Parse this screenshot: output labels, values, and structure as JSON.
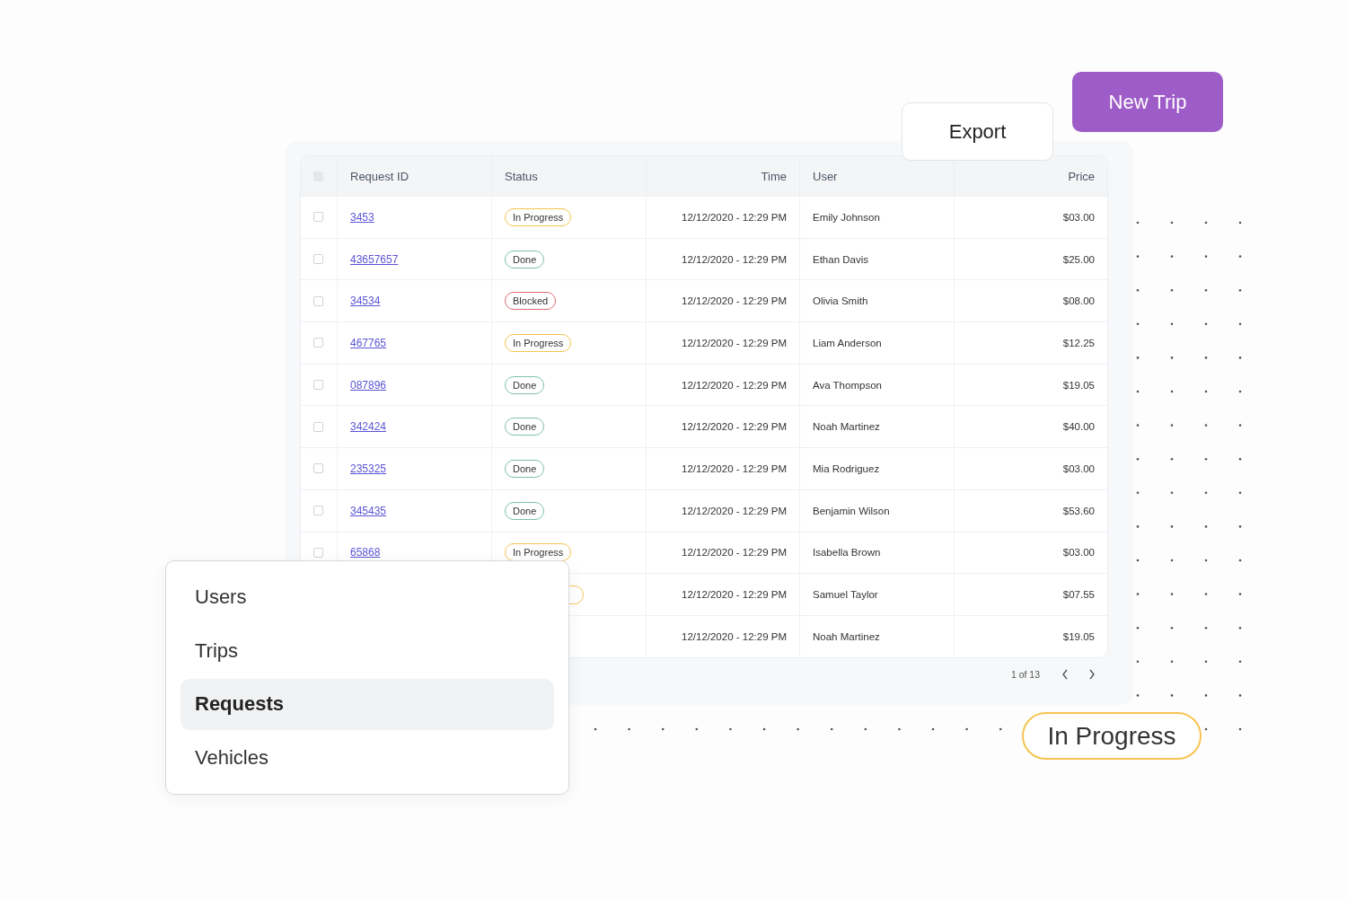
{
  "actions": {
    "export": "Export",
    "new_trip": "New Trip"
  },
  "table": {
    "select_all_checked": false,
    "columns": [
      "Request ID",
      "Status",
      "Time",
      "User",
      "Price"
    ],
    "rows": [
      {
        "checked": false,
        "id": "3453",
        "status": {
          "kind": "in_progress",
          "label": "In Progress"
        },
        "time": "12/12/2020 - 12:29 PM",
        "user": "Emily Johnson",
        "price": "$03.00"
      },
      {
        "checked": false,
        "id": "43657657",
        "status": {
          "kind": "done",
          "label": "Done"
        },
        "time": "12/12/2020 - 12:29 PM",
        "user": "Ethan Davis",
        "price": "$25.00"
      },
      {
        "checked": false,
        "id": "34534",
        "status": {
          "kind": "blocked",
          "label": "Blocked"
        },
        "time": "12/12/2020 - 12:29 PM",
        "user": "Olivia Smith",
        "price": "$08.00"
      },
      {
        "checked": false,
        "id": "467765",
        "status": {
          "kind": "in_progress",
          "label": "In Progress"
        },
        "time": "12/12/2020 - 12:29 PM",
        "user": "Liam Anderson",
        "price": "$12.25"
      },
      {
        "checked": false,
        "id": "087896",
        "status": {
          "kind": "done",
          "label": "Done"
        },
        "time": "12/12/2020 - 12:29 PM",
        "user": "Ava Thompson",
        "price": "$19.05"
      },
      {
        "checked": false,
        "id": "342424",
        "status": {
          "kind": "done",
          "label": "Done"
        },
        "time": "12/12/2020 - 12:29 PM",
        "user": "Noah Martinez",
        "price": "$40.00"
      },
      {
        "checked": false,
        "id": "235325",
        "status": {
          "kind": "done",
          "label": "Done"
        },
        "time": "12/12/2020 - 12:29 PM",
        "user": "Mia Rodriguez",
        "price": "$03.00"
      },
      {
        "checked": false,
        "id": "345435",
        "status": {
          "kind": "done",
          "label": "Done"
        },
        "time": "12/12/2020 - 12:29 PM",
        "user": "Benjamin Wilson",
        "price": "$53.60"
      },
      {
        "checked": false,
        "id": "65868",
        "status": {
          "kind": "in_progress",
          "label": "In Progress"
        },
        "time": "12/12/2020 - 12:29 PM",
        "user": "Isabella Brown",
        "price": "$03.00"
      },
      {
        "status": {
          "kind": "in_progress"
        },
        "time": "12/12/2020 - 12:29 PM",
        "user": "Samuel Taylor",
        "price": "$07.55"
      },
      {
        "time": "12/12/2020 - 12:29 PM",
        "user": "Noah Martinez",
        "price": "$19.05"
      }
    ],
    "pagination": "1 of 13"
  },
  "menu": [
    {
      "label": "Users",
      "selected": false
    },
    {
      "label": "Trips",
      "selected": false
    },
    {
      "label": "Requests",
      "selected": true
    },
    {
      "label": "Vehicles",
      "selected": false
    }
  ],
  "status_badge": {
    "kind": "in_progress",
    "label": "In Progress"
  }
}
